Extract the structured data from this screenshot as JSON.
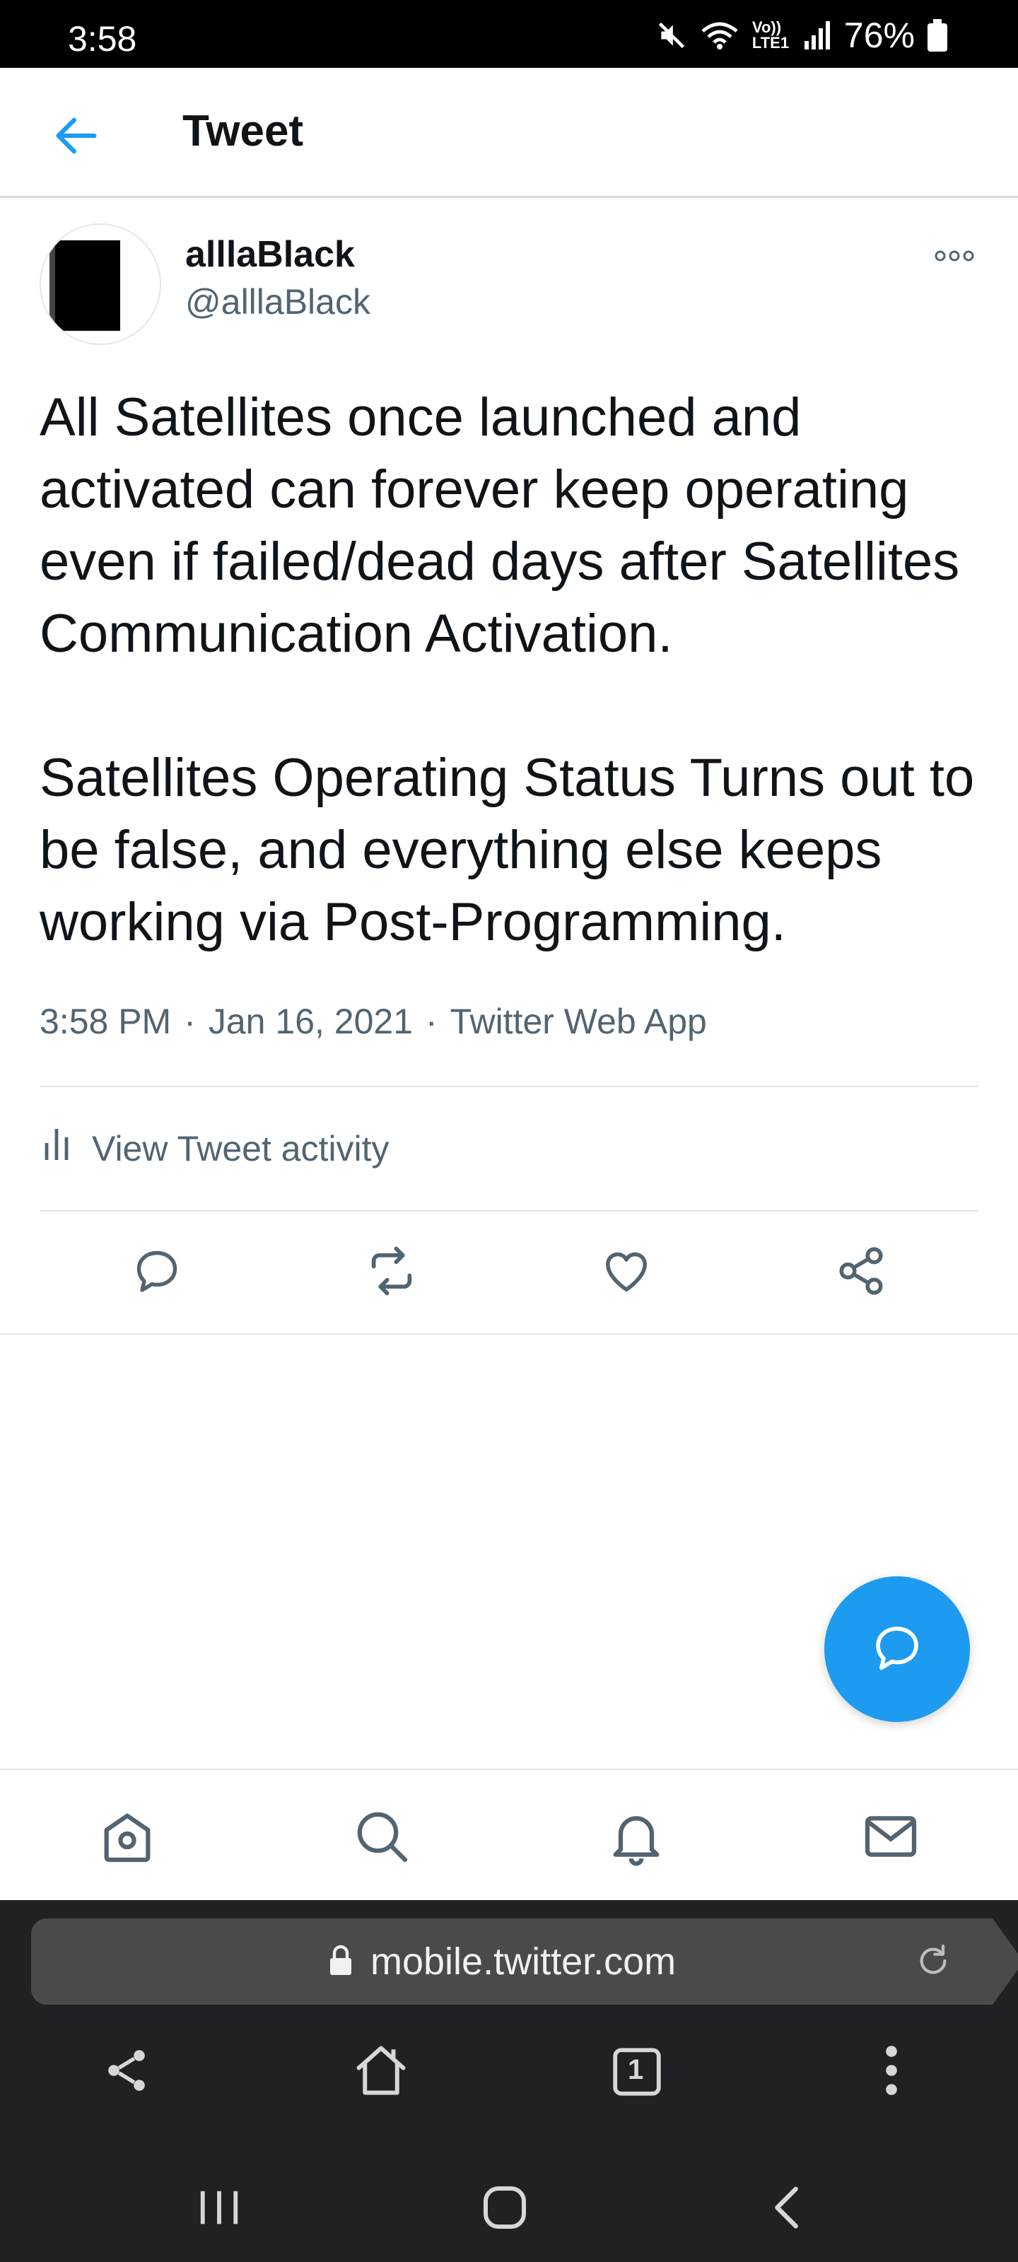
{
  "status_bar": {
    "time": "3:58",
    "network_label": "Vo)) LTE1",
    "battery": "76%",
    "icons": [
      "mute-icon",
      "wifi-icon",
      "signal-icon",
      "battery-icon"
    ]
  },
  "header": {
    "title": "Tweet",
    "back_icon": "arrow-left-icon"
  },
  "tweet": {
    "author_name": "alllaBlack",
    "author_handle": "@alllaBlack",
    "paragraph1": "All Satellites once launched and activated can forever keep operating even if failed/dead days after Satellites Communication Activation.",
    "paragraph2": "Satellites Operating Status Turns out to be false, and everything else keeps working via Post-Programming.",
    "time": "3:58 PM",
    "date": "Jan 16, 2021",
    "source": "Twitter Web App",
    "separator": "·",
    "activity_label": "View Tweet activity"
  },
  "actions": [
    "reply-icon",
    "retweet-icon",
    "like-icon",
    "share-icon"
  ],
  "bottom_nav": [
    "home-icon",
    "search-icon",
    "notifications-icon",
    "messages-icon"
  ],
  "browser": {
    "url": "mobile.twitter.com",
    "tab_count": "1"
  },
  "colors": {
    "accent": "#1d9bf0",
    "secondary_text": "#536471",
    "icon": "#536471"
  }
}
